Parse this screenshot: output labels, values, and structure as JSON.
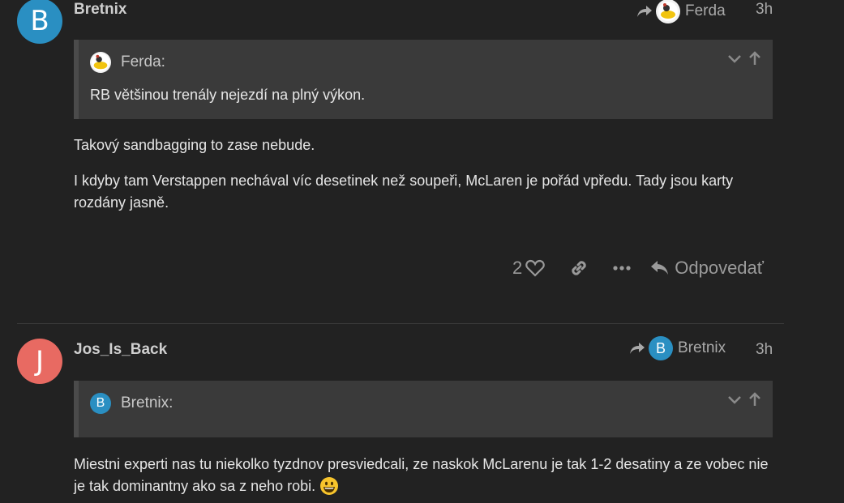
{
  "post1": {
    "avatar_letter": "B",
    "avatar_color": "#2a8fc2",
    "username": "Bretnix",
    "reply_to": "Ferda",
    "time": "3h",
    "quote": {
      "author": "Ferda:",
      "text": "RB většinou trenály nejezdí na plný výkon."
    },
    "paragraphs": [
      "Takový sandbagging to zase nebude.",
      "I kdyby tam Verstappen nechával víc desetinek než soupeři, McLaren je pořád vpředu. Tady jsou karty rozdány jasně."
    ],
    "likes": "2",
    "reply_label": "Odpovedať"
  },
  "post2": {
    "avatar_letter": "J",
    "avatar_color": "#e86a62",
    "username": "Jos_Is_Back",
    "reply_to": "Bretnix",
    "reply_to_letter": "B",
    "time": "3h",
    "quote": {
      "author": "Bretnix:",
      "author_letter": "B"
    },
    "paragraph": "Miestni experti nas tu niekolko tyzdnov presviedcali, ze naskok McLarenu je tak 1-2 desatiny a ze vobec nie je tak dominantny ako sa z neho robi."
  }
}
